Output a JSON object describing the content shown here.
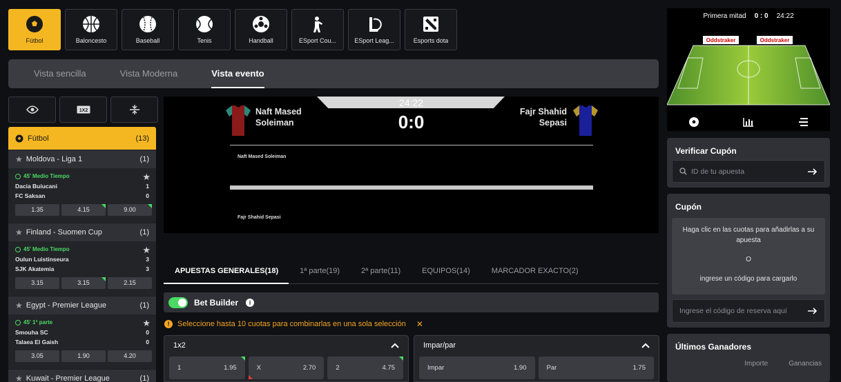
{
  "sports": [
    {
      "label": "Fútbol",
      "icon": "soccer-ball-icon",
      "active": true
    },
    {
      "label": "Baloncesto",
      "icon": "basketball-icon"
    },
    {
      "label": "Baseball",
      "icon": "baseball-icon"
    },
    {
      "label": "Tenis",
      "icon": "tennis-ball-icon"
    },
    {
      "label": "Handball",
      "icon": "handball-icon"
    },
    {
      "label": "ESport Cou...",
      "icon": "shooter-icon"
    },
    {
      "label": "ESport Leag...",
      "icon": "league-icon"
    },
    {
      "label": "Esports dota",
      "icon": "dota-icon"
    }
  ],
  "view_tabs": [
    "Vista sencilla",
    "Vista Moderna",
    "Vista evento"
  ],
  "left": {
    "sport": {
      "name": "Fútbol",
      "count": "(13)"
    },
    "leagues": [
      {
        "name": "Moldova - Liga 1",
        "count": "(1)",
        "status": "45' Medio Tiempo",
        "home": "Dacia Buiucani",
        "home_score": "1",
        "away": "FC Saksan",
        "away_score": "0",
        "odds": [
          "1.35",
          "4.15",
          "9.00"
        ]
      },
      {
        "name": "Finland - Suomen Cup",
        "count": "(1)",
        "status": "45' Medio Tiempo",
        "home": "Oulun Luistinseura",
        "home_score": "3",
        "away": "SJK Akatemia",
        "away_score": "3",
        "odds": [
          "3.15",
          "3.15",
          "2.15"
        ]
      },
      {
        "name": "Egypt - Premier League",
        "count": "(1)",
        "status": "45' 1ª parte",
        "home": "Smouha SC",
        "home_score": "0",
        "away": "Talaea El Gaish",
        "away_score": "0",
        "odds": [
          "3.05",
          "1.90",
          "4.20"
        ]
      },
      {
        "name": "Kuwait - Premier League",
        "count": "(1)"
      }
    ]
  },
  "event": {
    "time": "24:22",
    "score": "0:0",
    "home_line1": "Naft Mased",
    "home_line2": "Soleiman",
    "away_line1": "Fajr Shahid",
    "away_line2": "Sepasi",
    "home_full": "Naft Mased Soleiman",
    "away_full": "Fajr Shahid Sepasi"
  },
  "bet_tabs": [
    "APUESTAS GENERALES(18)",
    "1ª parte(19)",
    "2ª parte(11)",
    "EQUIPOS(14)",
    "MARCADOR EXACTO(2)"
  ],
  "bet_builder": {
    "label": "Bet Builder",
    "enabled": true
  },
  "warning": "Seleccione hasta 10 cuotas para combinarlas en una sola selección",
  "markets": [
    {
      "title": "1x2",
      "selections": [
        {
          "name": "1",
          "odd": "1.95"
        },
        {
          "name": "X",
          "odd": "2.70"
        },
        {
          "name": "2",
          "odd": "4.75"
        }
      ]
    },
    {
      "title": "Impar/par",
      "selections": [
        {
          "name": "Impar",
          "odd": "1.90"
        },
        {
          "name": "Par",
          "odd": "1.75"
        }
      ]
    }
  ],
  "field": {
    "period": "Primera mitad",
    "score": "0 : 0",
    "time": "24:22",
    "ad": "Oddstraker"
  },
  "verify": {
    "title": "Verificar Cupón",
    "placeholder": "ID de tu apuesta"
  },
  "coupon": {
    "title": "Cupón",
    "info1": "Haga clic en las cuotas para añadirlas a su apuesta",
    "or": "O",
    "info2": "ingrese un código para cargarlo",
    "placeholder": "Ingrese el código de reserva aquí"
  },
  "winners": {
    "title": "Últimos Ganadores",
    "col1": "Importe",
    "col2": "Ganancias"
  },
  "colors": {
    "accent": "#f5b721",
    "up": "#4cd964",
    "warn": "#f5a623"
  }
}
